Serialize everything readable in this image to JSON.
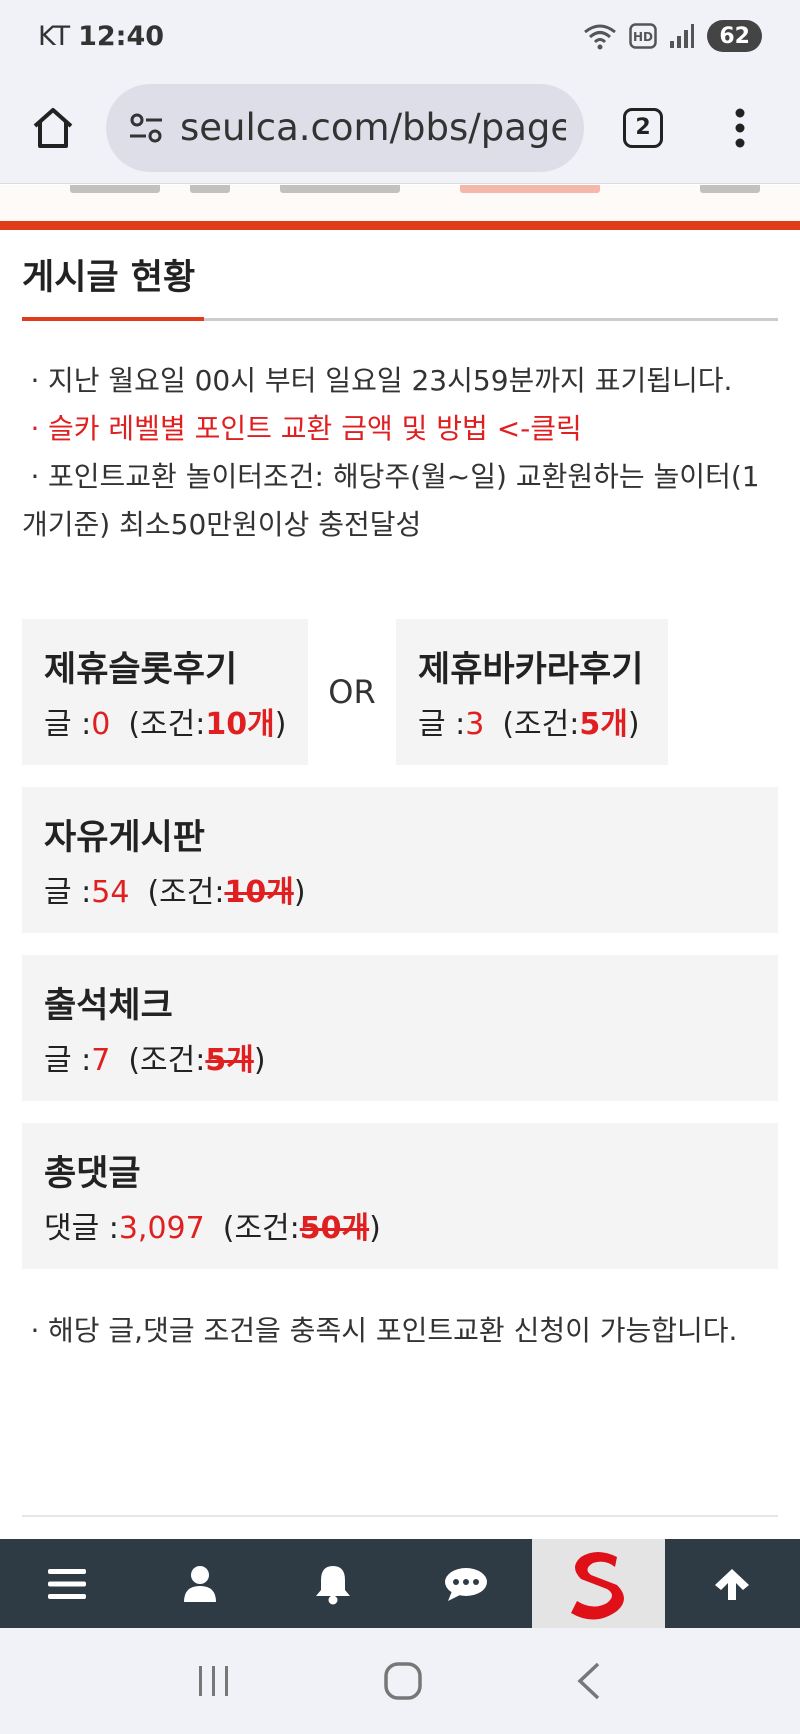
{
  "status_bar": {
    "carrier": "KT",
    "time": "12:40",
    "battery": "62",
    "icons": [
      "wifi-icon",
      "hd-icon",
      "signal-icon",
      "battery-icon"
    ]
  },
  "browser": {
    "url": "seulca.com/bbs/page.php",
    "tab_count": "2",
    "icons": [
      "home-icon",
      "site-settings-icon",
      "tabs-icon",
      "more-menu-icon"
    ]
  },
  "section": {
    "title": "게시글 현황"
  },
  "notices": {
    "item1": "지난 월요일 00시 부터 일요일 23시59분까지 표기됩니다.",
    "item2": "슬카 레벨별 포인트 교환 금액 및 방법 <-클릭",
    "item3": "포인트교환 놀이터조건: 해당주(월~일) 교환원하는 놀이터(1개기준) 최소50만원이상 충전달성",
    "bullet": "·"
  },
  "boards": {
    "or_label": "OR",
    "slot": {
      "title": "제휴슬롯후기",
      "label": "글 :",
      "count": "0",
      "cond_prefix": "(조건:",
      "cond_value": "10개",
      "cond_suffix": ")"
    },
    "baccarat": {
      "title": "제휴바카라후기",
      "label": "글 :",
      "count": "3",
      "cond_prefix": "(조건:",
      "cond_value": "5개",
      "cond_suffix": ")"
    },
    "free": {
      "title": "자유게시판",
      "label": "글 :",
      "count": "54",
      "cond_prefix": "(조건:",
      "cond_value": "10개",
      "cond_suffix": ")"
    },
    "attendance": {
      "title": "출석체크",
      "label": "글 :",
      "count": "7",
      "cond_prefix": "(조건:",
      "cond_value": "5개",
      "cond_suffix": ")"
    },
    "comments": {
      "title": "총댓글",
      "label": "댓글 :",
      "count": "3,097",
      "cond_prefix": "(조건:",
      "cond_value": "50개",
      "cond_suffix": ")"
    }
  },
  "bottom_note": "해당 글,댓글 조건을 충족시 포인트교환 신청이 가능합니다.",
  "bottom_nav": {
    "items": [
      "menu-icon",
      "user-icon",
      "bell-icon",
      "chat-icon",
      "site-logo",
      "arrow-up-icon"
    ],
    "logo_letter": "S"
  },
  "colors": {
    "accent_red": "#e03c1a",
    "text_red": "#e02020",
    "nav_bg": "#2e3a44",
    "card_bg": "#f4f4f4"
  }
}
